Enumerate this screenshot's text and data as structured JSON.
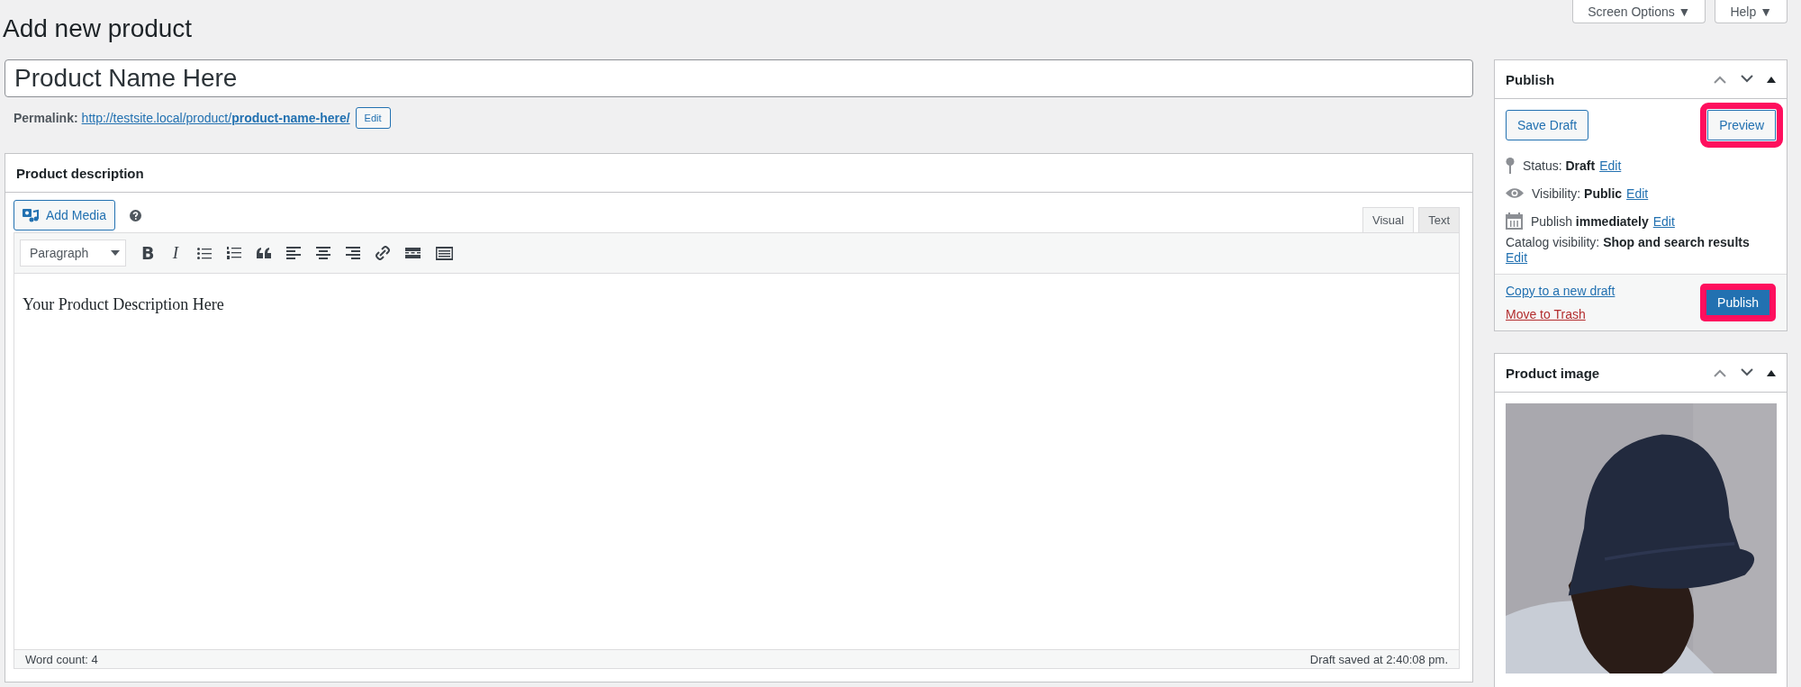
{
  "header_buttons": [
    {
      "label": "Screen Options",
      "caret": "▼"
    },
    {
      "label": "Help",
      "caret": "▼"
    }
  ],
  "page_title": "Add new product",
  "title_field": {
    "value": "Product Name Here"
  },
  "permalink": {
    "label": "Permalink:",
    "url": "http://testsite.local/product/**product-name-here/**",
    "edit": "Edit"
  },
  "description": {
    "title": "Product description",
    "add_media": "Add Media",
    "tabs": [
      {
        "label": "Visual",
        "selected": true
      },
      {
        "label": "Text",
        "selected": false
      }
    ],
    "format_select": "Paragraph",
    "toolbar": [
      {
        "kind": "bold",
        "label": "B"
      },
      {
        "kind": "italic",
        "label": "I"
      },
      {
        "kind": "bullets"
      },
      {
        "kind": "numbers"
      },
      {
        "kind": "quote"
      },
      {
        "kind": "align-left"
      },
      {
        "kind": "align-center"
      },
      {
        "kind": "align-right"
      },
      {
        "kind": "link"
      },
      {
        "kind": "more"
      },
      {
        "kind": "keyboard"
      }
    ],
    "content": "Your Product Description Here",
    "word_count": "Word count: 4",
    "draft_saved": "Draft saved at 2:40:08 pm."
  },
  "publish": {
    "title": "Publish",
    "save_draft": {
      "label": "Save Draft",
      "highlighted": false
    },
    "preview": {
      "label": "Preview",
      "highlighted": true
    },
    "rows": [
      {
        "kind": "status",
        "text": "Status: **Draft**",
        "edit": "Edit"
      },
      {
        "kind": "visibility",
        "text": "Visibility: **Public**",
        "edit": "Edit"
      },
      {
        "kind": "schedule",
        "text": "Publish **immediately**",
        "edit": "Edit"
      },
      {
        "kind": "catalog",
        "text": "Catalog visibility: **Shop and search results**",
        "edit": "Edit"
      }
    ],
    "copy_link": "Copy to a new draft",
    "trash_link": "Move to Trash",
    "publish_button": {
      "label": "Publish",
      "highlighted": true
    }
  },
  "product_image": {
    "title": "Product image"
  }
}
